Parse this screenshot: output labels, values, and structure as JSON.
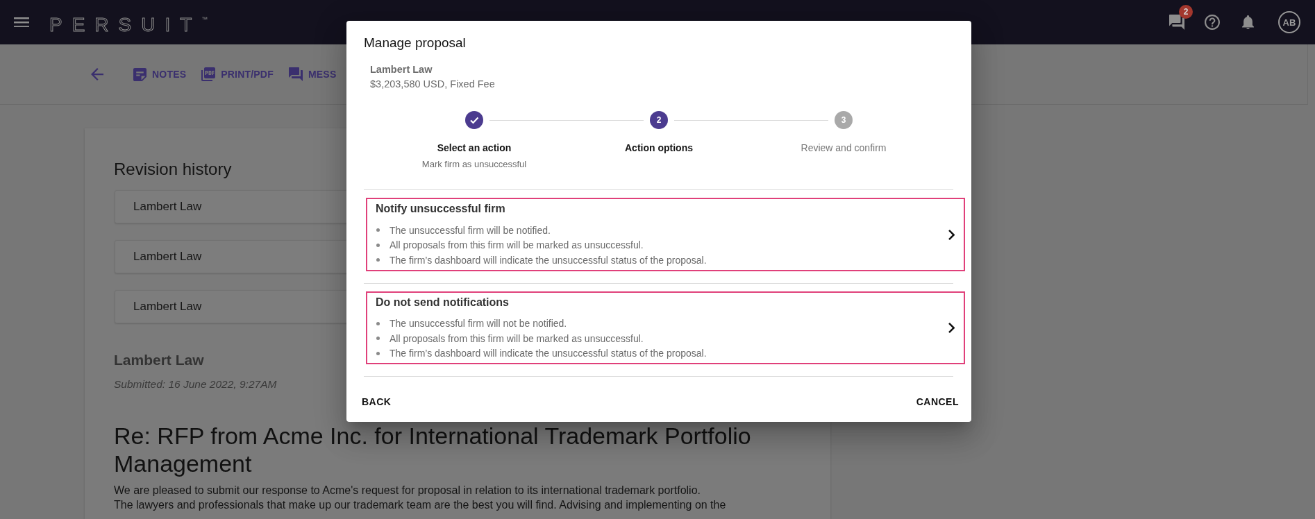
{
  "top_bar": {
    "logo": "PERSUIT$^{™}$",
    "messages_badge": "2",
    "avatar_initials": "AB"
  },
  "toolbar": {
    "items": [
      {
        "kind": "notes",
        "label": "NOTES"
      },
      {
        "kind": "pdf",
        "label": "PRINT/PDF"
      },
      {
        "kind": "messages",
        "label": "MESS"
      }
    ]
  },
  "page": {
    "section_title": "Revision history",
    "revisions": [
      {
        "name": "Lambert Law"
      },
      {
        "name": "Lambert Law"
      },
      {
        "name": "Lambert Law"
      }
    ],
    "firm_name": "Lambert Law",
    "submitted": "Submitted: 16 June 2022, 9:27AM",
    "proposal_title": "Re: RFP from Acme Inc. for International Trademark Portfolio Management",
    "paragraphs": [
      "We are pleased to submit our response to Acme's request for proposal in relation to its international trademark portfolio.",
      "The lawyers and professionals that make up our trademark team are the best you will find. Advising and implementing on the"
    ]
  },
  "modal": {
    "title": "Manage proposal",
    "firm": "Lambert Law",
    "price": "$3,203,580 USD, Fixed Fee",
    "steps": [
      {
        "completed": true,
        "active": false,
        "label": "Select an action",
        "caption": "Mark firm as unsuccessful"
      },
      {
        "completed": false,
        "active": true,
        "number": "2",
        "label": "Action options"
      },
      {
        "completed": false,
        "active": false,
        "number": "3",
        "label": "Review and confirm"
      }
    ],
    "options": [
      {
        "title": "Notify unsuccessful firm",
        "points": [
          "The unsuccessful firm will be notified.",
          "All proposals from this firm will be marked as unsuccessful.",
          "The firm’s dashboard will indicate the unsuccessful status of the proposal."
        ]
      },
      {
        "title": "Do not send notifications",
        "points": [
          "The unsuccessful firm will not be notified.",
          "All proposals from this firm will be marked as unsuccessful.",
          "The firm’s dashboard will indicate the unsuccessful status of the proposal."
        ]
      }
    ],
    "back": "BACK",
    "cancel": "CANCEL"
  }
}
